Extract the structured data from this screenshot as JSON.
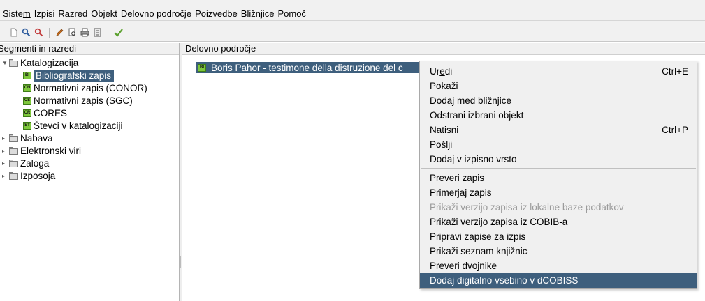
{
  "menubar": [
    "Sistem",
    "Izpisi",
    "Razred",
    "Objekt",
    "Delovno področje",
    "Poizvedbe",
    "Bližnjice",
    "Pomoč"
  ],
  "toolbar": {
    "icons": [
      "new-document-icon",
      "search-icon",
      "advanced-search-icon",
      "edit-pencil-icon",
      "preview-icon",
      "print-icon",
      "calculator-icon",
      "check-icon"
    ]
  },
  "left_panel": {
    "title": "Segmenti in razredi",
    "tree": [
      {
        "label": "Katalogizacija",
        "expanded": true,
        "children": [
          {
            "label": "Bibliografski zapis",
            "badge": "BI",
            "selected": true
          },
          {
            "label": "Normativni zapis (CONOR)",
            "badge": "CN"
          },
          {
            "label": "Normativni zapis (SGC)",
            "badge": "CS"
          },
          {
            "label": "CORES",
            "badge": "CR"
          },
          {
            "label": "Števci v katalogizaciji",
            "badge": "ŠT"
          }
        ]
      },
      {
        "label": "Nabava",
        "expanded": false
      },
      {
        "label": "Elektronski viri",
        "expanded": false
      },
      {
        "label": "Zaloga",
        "expanded": false
      },
      {
        "label": "Izposoja",
        "expanded": false
      }
    ]
  },
  "right_panel": {
    "title": "Delovno področje",
    "record": {
      "badge": "BI",
      "text": "Boris Pahor - testimone della distruzione del c"
    }
  },
  "context_menu": {
    "groups": [
      [
        {
          "label": "Uredi",
          "shortcut": "Ctrl+E"
        },
        {
          "label": "Pokaži",
          "shortcut": ""
        },
        {
          "label": "Dodaj med bližnjice",
          "shortcut": ""
        },
        {
          "label": "Odstrani izbrani objekt",
          "shortcut": ""
        },
        {
          "label": "Natisni",
          "shortcut": "Ctrl+P"
        },
        {
          "label": "Pošlji",
          "shortcut": ""
        },
        {
          "label": "Dodaj v izpisno vrsto",
          "shortcut": ""
        }
      ],
      [
        {
          "label": "Preveri zapis",
          "shortcut": ""
        },
        {
          "label": "Primerjaj zapis",
          "shortcut": ""
        },
        {
          "label": "Prikaži verzijo zapisa iz lokalne baze podatkov",
          "shortcut": "",
          "disabled": true
        },
        {
          "label": "Prikaži verzijo zapisa iz COBIB-a",
          "shortcut": ""
        },
        {
          "label": "Pripravi zapise za izpis",
          "shortcut": ""
        },
        {
          "label": "Prikaži seznam knjižnic",
          "shortcut": ""
        },
        {
          "label": "Preveri dvojnike",
          "shortcut": ""
        },
        {
          "label": "Dodaj digitalno vsebino v dCOBISS",
          "shortcut": "",
          "highlighted": true
        }
      ]
    ]
  },
  "colors": {
    "selection": "#3e5f7d",
    "badge": "#7ec73c",
    "chrome": "#f1f1f1"
  }
}
